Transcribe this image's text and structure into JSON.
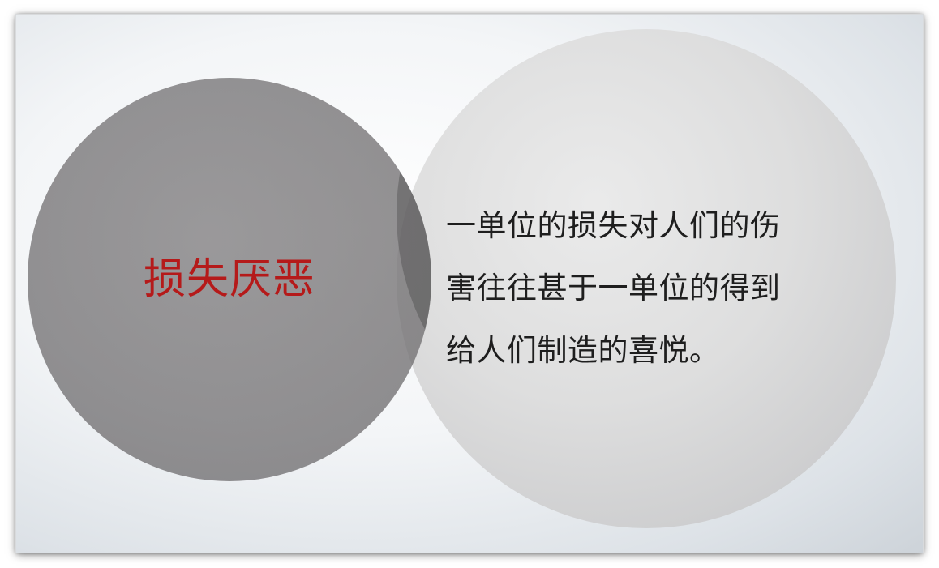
{
  "slide": {
    "left_circle": {
      "title": "损失厌恶",
      "title_color": "#b51a1a"
    },
    "right_circle": {
      "lines": [
        "一单位的损失对人们的伤",
        "害往往甚于一单位的得到",
        "给人们制造的喜悦。"
      ]
    }
  }
}
